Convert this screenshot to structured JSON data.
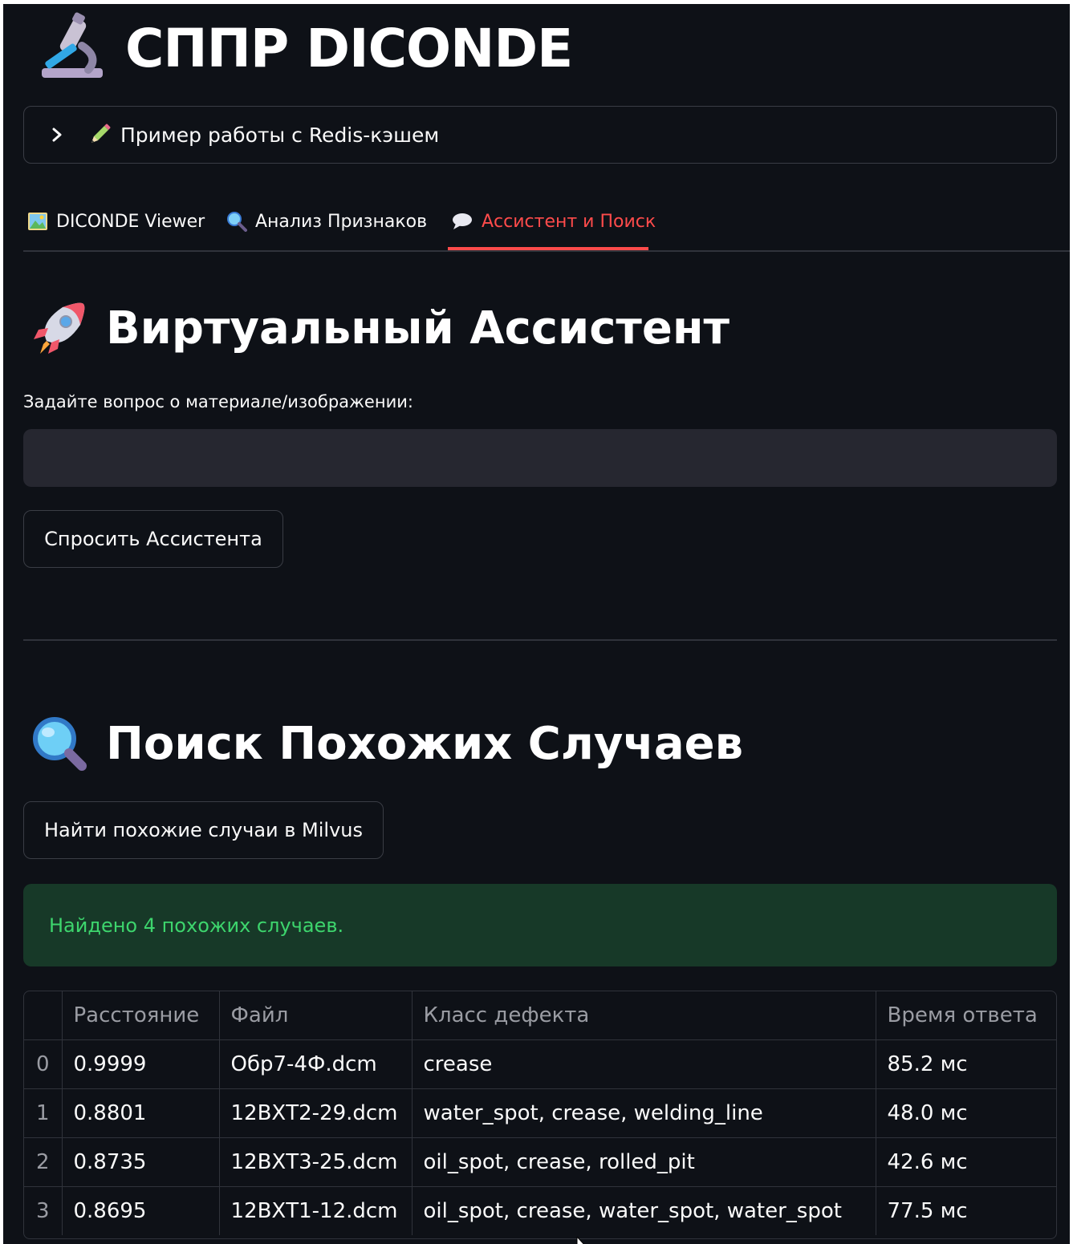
{
  "app": {
    "title": "СППР DICONDE"
  },
  "expander": {
    "label": "Пример работы с Redis-кэшем"
  },
  "tabs": [
    {
      "label": "DICONDE Viewer",
      "icon": "picture-icon",
      "active": false
    },
    {
      "label": "Анализ Признаков",
      "icon": "magnifier-icon",
      "active": false
    },
    {
      "label": "Ассистент и Поиск",
      "icon": "speech-bubble-icon",
      "active": true
    }
  ],
  "assistant": {
    "heading": "Виртуальный Ассистент",
    "icon": "rocket-icon",
    "question_label": "Задайте вопрос о материале/изображении:",
    "question_value": "",
    "ask_button": "Спросить Ассистента"
  },
  "search": {
    "heading": "Поиск Похожих Случаев",
    "icon": "magnifier-icon",
    "find_button": "Найти похожие случаи в Milvus",
    "success_message": "Найдено 4 похожих случаев.",
    "columns": [
      "",
      "Расстояние",
      "Файл",
      "Класс дефекта",
      "Время ответа"
    ],
    "rows": [
      [
        "0",
        "0.9999",
        "Обр7-4Ф.dcm",
        "crease",
        "85.2 мс"
      ],
      [
        "1",
        "0.8801",
        "12ВХТ2-29.dcm",
        "water_spot, crease, welding_line",
        "48.0 мс"
      ],
      [
        "2",
        "0.8735",
        "12ВХТ3-25.dcm",
        "oil_spot, crease, rolled_pit",
        "42.6 мс"
      ],
      [
        "3",
        "0.8695",
        "12ВХТ1-12.dcm",
        "oil_spot, crease, water_spot, water_spot",
        "77.5 мс"
      ]
    ]
  },
  "colors": {
    "background": "#0e1117",
    "accent": "#ff4b4b",
    "success_bg": "#173928",
    "success_text": "#3dd56d",
    "input_bg": "#262730"
  }
}
